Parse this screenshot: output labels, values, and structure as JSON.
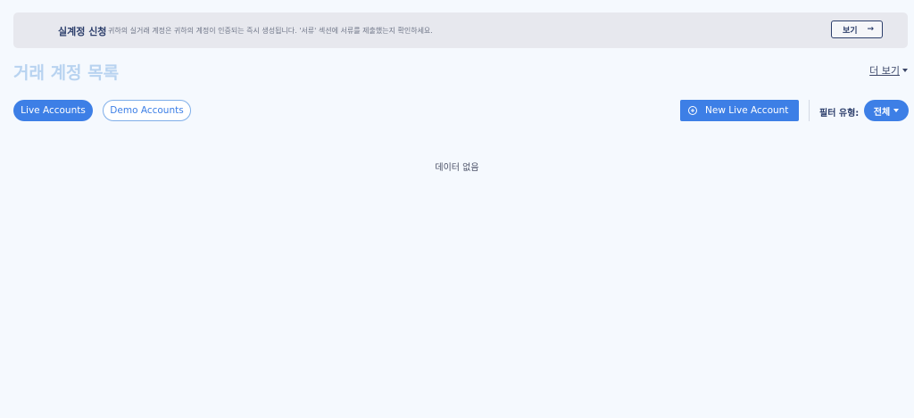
{
  "banner": {
    "title": "실계정 신청",
    "text": "귀하의 실거래 계정은 귀하의 계정이 인증되는 즉시 생성됩니다. '서류' 섹션에 서류를 제출했는지 확인하세요.",
    "button_label": "보기",
    "button_icon": "→"
  },
  "page": {
    "title": "거래 계정 목록",
    "more_label": "더 보기"
  },
  "tabs": {
    "live": "Live Accounts",
    "demo": "Demo Accounts",
    "active": "live"
  },
  "actions": {
    "new_account_label": "New Live Account"
  },
  "filter": {
    "label": "필터 유형:",
    "selected": "전체"
  },
  "empty_state": "데이터 없음",
  "colors": {
    "accent": "#3d7fe6",
    "title_light": "#b8d3f0",
    "navy": "#2c3e6b",
    "background": "#f5f9fe"
  }
}
